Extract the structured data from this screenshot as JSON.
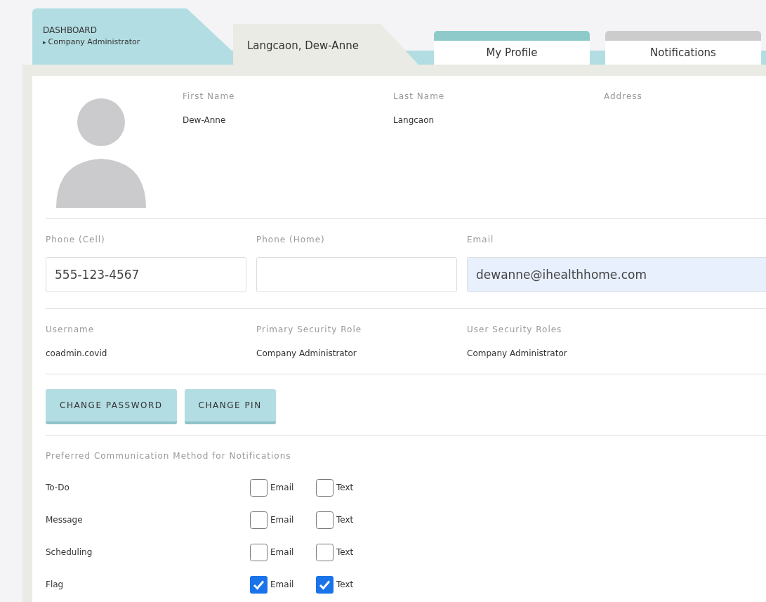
{
  "dashboard_tab": {
    "title": "DASHBOARD",
    "arrow": "▸",
    "subtitle": "Company Administrator"
  },
  "record_tab": {
    "label": "Langcaon, Dew-Anne"
  },
  "tabs": [
    {
      "label": "My Profile",
      "selected": true
    },
    {
      "label": "Notifications",
      "selected": false
    }
  ],
  "name_fields": [
    {
      "label": "First Name",
      "value": "Dew-Anne"
    },
    {
      "label": "Last Name",
      "value": "Langcaon"
    },
    {
      "label": "Address"
    }
  ],
  "contact_fields": [
    {
      "label": "Phone (Cell)",
      "value": "555-123-4567",
      "autofilled": false
    },
    {
      "label": "Phone (Home)",
      "autofilled": false
    },
    {
      "label": "Email",
      "value": "dewanne@ihealthhome.com",
      "autofilled": true
    }
  ],
  "security_fields": [
    {
      "label": "Username",
      "value": "coadmin.covid"
    },
    {
      "label": "Primary Security Role",
      "value": "Company Administrator"
    },
    {
      "label": "User Security Roles",
      "value": "Company Administrator"
    }
  ],
  "buttons": [
    "CHANGE PASSWORD",
    "CHANGE PIN"
  ],
  "notifications": {
    "heading": "Preferred Communication Method for Notifications",
    "rows": [
      {
        "label": "To-Do",
        "options": [
          {
            "label": "Email",
            "checked": false
          },
          {
            "label": "Text",
            "checked": false
          }
        ]
      },
      {
        "label": "Message",
        "options": [
          {
            "label": "Email",
            "checked": false
          },
          {
            "label": "Text",
            "checked": false
          }
        ]
      },
      {
        "label": "Scheduling",
        "options": [
          {
            "label": "Email",
            "checked": false
          },
          {
            "label": "Text",
            "checked": false
          }
        ]
      },
      {
        "label": "Flag",
        "options": [
          {
            "label": "Email",
            "checked": true
          },
          {
            "label": "Text",
            "checked": true
          }
        ]
      }
    ]
  }
}
